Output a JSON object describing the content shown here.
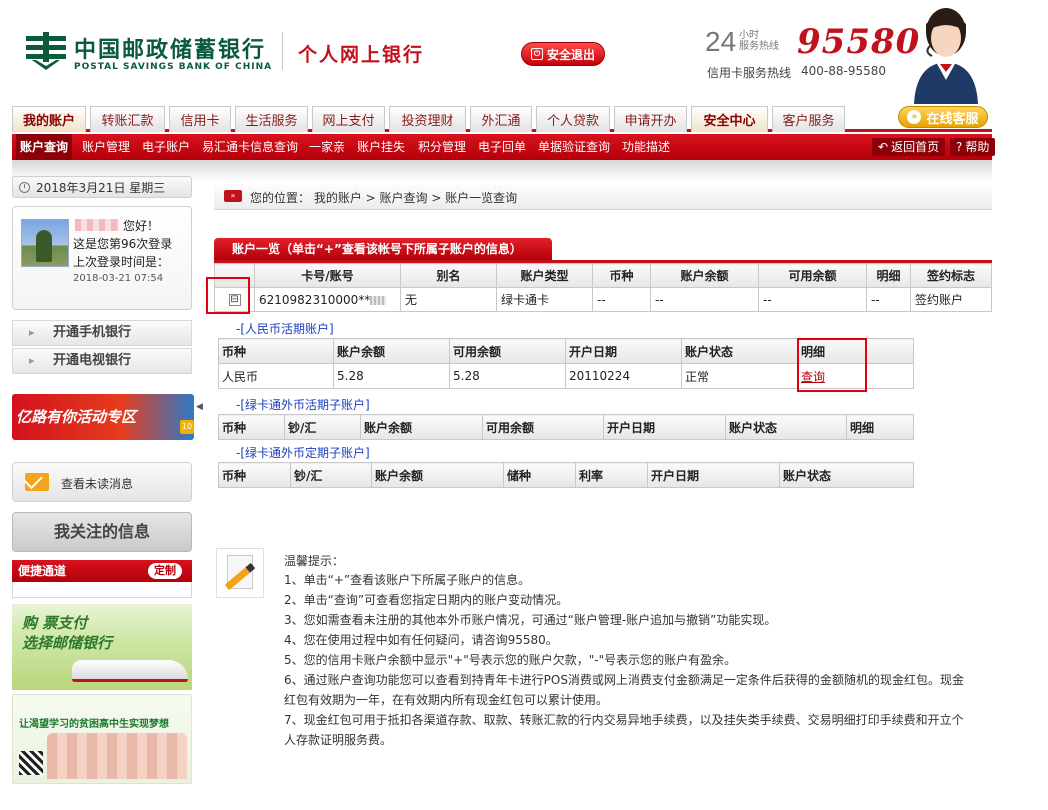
{
  "header": {
    "bank_name_cn": "中国邮政储蓄银行",
    "bank_name_en": "POSTAL SAVINGS BANK OF CHINA",
    "product_name": "个人网上银行",
    "logout_label": "安全退出",
    "hotline_24": "24",
    "hotline_24_label": "小时\n服务热线",
    "hotline_number": "95580",
    "card_hotline_label": "信用卡服务热线",
    "card_hotline_number": "400-88-95580"
  },
  "nav": {
    "tabs": [
      {
        "label": "我的账户"
      },
      {
        "label": "转账汇款"
      },
      {
        "label": "信用卡"
      },
      {
        "label": "生活服务"
      },
      {
        "label": "网上支付"
      },
      {
        "label": "投资理财"
      },
      {
        "label": "外汇通"
      },
      {
        "label": "个人贷款"
      },
      {
        "label": "申请开办"
      },
      {
        "label": "安全中心"
      },
      {
        "label": "客户服务"
      }
    ],
    "online_service": "在线客服"
  },
  "subnav": {
    "items": [
      {
        "label": "账户查询"
      },
      {
        "label": "账户管理"
      },
      {
        "label": "电子账户"
      },
      {
        "label": "易汇通卡信息查询"
      },
      {
        "label": "一家亲"
      },
      {
        "label": "账户挂失"
      },
      {
        "label": "积分管理"
      },
      {
        "label": "电子回单"
      },
      {
        "label": "单据验证查询"
      },
      {
        "label": "功能描述"
      }
    ],
    "back_home": "返回首页",
    "help": "帮助"
  },
  "sidebar": {
    "date": "2018年3月21日 星期三",
    "greeting": "您好！",
    "login_count": "这是您第96次登录",
    "last_login_label": "上次登录时间是：",
    "last_login_time": "2018-03-21 07:54",
    "links": [
      {
        "label": "开通手机银行"
      },
      {
        "label": "开通电视银行"
      }
    ],
    "promo_text": "亿路有你活动专区",
    "promo_badge": "10",
    "collapse_glyph": "◀",
    "unread_label": "查看未读消息",
    "follow_label": "我关注的信息",
    "quick_title": "便捷通道",
    "customize_label": "定制",
    "ad_train_line1": "购  票支付",
    "ad_train_line2": "选择邮储银行",
    "ad_students_text": "让渴望学习的贫困高中生实现梦想"
  },
  "breadcrumb": {
    "text": "您的位置： 我的账户 >  账户查询 >  账户一览查询",
    "icon_glyph": "»"
  },
  "account_list": {
    "header": "账户一览（单击“+”查看该帐号下所属子账户的信息）",
    "columns": [
      "卡号/账号",
      "别名",
      "账户类型",
      "币种",
      "账户余额",
      "可用余额",
      "明细",
      "签约标志"
    ],
    "rows": [
      {
        "toggle": "⊟",
        "account": "6210982310000**",
        "alias": "无",
        "type": "绿卡通卡",
        "currency": "--",
        "balance": "--",
        "available": "--",
        "detail": "--",
        "sign": "签约账户"
      }
    ]
  },
  "rmb_current": {
    "title": "-[人民币活期账户]",
    "columns": [
      "币种",
      "账户余额",
      "可用余额",
      "开户日期",
      "账户状态",
      "明细"
    ],
    "rows": [
      {
        "currency": "人民币",
        "balance": "5.28",
        "available": "5.28",
        "open_date": "20110224",
        "status": "正常",
        "detail": "查询"
      }
    ]
  },
  "fx_current": {
    "title": "-[绿卡通外币活期子账户]",
    "columns": [
      "币种",
      "钞/汇",
      "账户余额",
      "可用余额",
      "开户日期",
      "账户状态",
      "明细"
    ]
  },
  "fx_fixed": {
    "title": "-[绿卡通外币定期子账户]",
    "columns": [
      "币种",
      "钞/汇",
      "账户余额",
      "储种",
      "利率",
      "开户日期",
      "账户状态"
    ]
  },
  "tips": {
    "title": "温馨提示：",
    "items": [
      "1、单击“+”查看该账户下所属子账户的信息。",
      "2、单击“查询”可查看您指定日期内的账户变动情况。",
      "3、您如需查看未注册的其他本外币账户情况，可通过“账户管理-账户追加与撤销”功能实现。",
      "4、您在使用过程中如有任何疑问，请咨询95580。",
      "5、您的信用卡账户余额中显示\"+\"号表示您的账户欠款，\"-\"号表示您的账户有盈余。",
      "6、通过账户查询功能您可以查看到持青年卡进行POS消费或网上消费支付金额满足一定条件后获得的金额随机的现金红包。现金",
      "红包有效期为一年，在有效期内所有现金红包可以累计使用。",
      "7、现金红包可用于抵扣各渠道存款、取款、转账汇款的行内交易异地手续费，以及挂失类手续费、交易明细打印手续费和开立个",
      "人存款证明服务费。"
    ]
  },
  "colors": {
    "brand_red": "#c0121d",
    "brand_green": "#0b5a3b",
    "link_blue": "#1c3fbf",
    "highlight_red": "#e00010"
  }
}
